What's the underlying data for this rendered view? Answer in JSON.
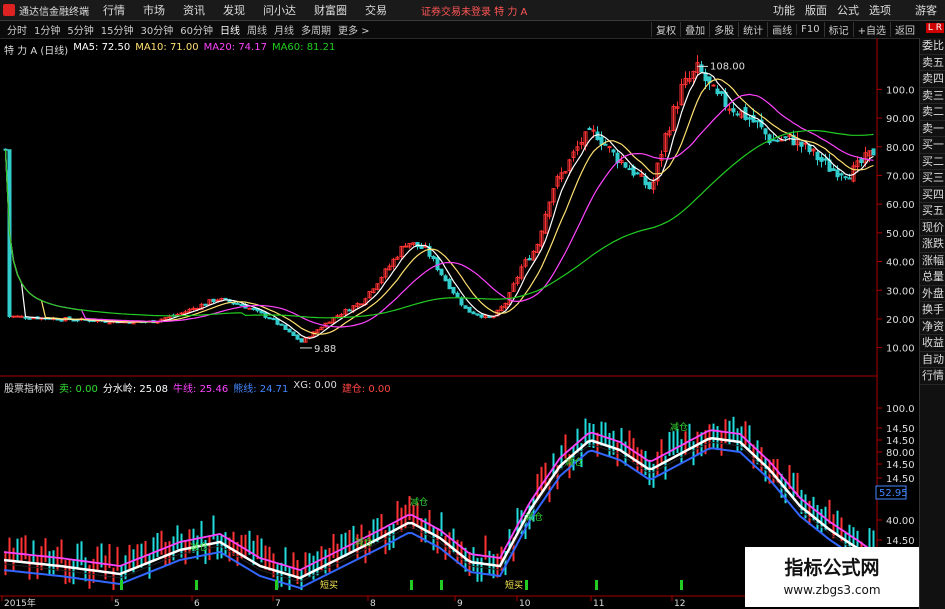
{
  "menubar": {
    "app_title": "通达信金融终端",
    "items": [
      "行情",
      "市场",
      "资讯",
      "发现",
      "问小达",
      "财富圈",
      "交易"
    ],
    "trade_status": "证券交易未登录  特 力 A",
    "right_items": [
      "功能",
      "版面",
      "公式",
      "选项"
    ],
    "guest": "游客"
  },
  "toolbar": {
    "timeframes": [
      "分时",
      "1分钟",
      "5分钟",
      "15分钟",
      "30分钟",
      "60分钟",
      "日线",
      "周线",
      "月线",
      "多周期",
      "更多 >"
    ],
    "active_timeframe": "日线",
    "tools": [
      "复权",
      "叠加",
      "多股",
      "统计",
      "画线",
      "F10",
      "标记",
      "+自选",
      "返回"
    ]
  },
  "main_chart": {
    "stock_label": "特 力 A (日线)",
    "ma5": "MA5: 72.50",
    "ma10": "MA10: 71.00",
    "ma20": "MA20: 74.17",
    "ma60": "MA60: 81.21",
    "high_label": "108.00",
    "low_label": "9.88",
    "axis_ticks": [
      "100.0",
      "90.00",
      "80.00",
      "70.00",
      "60.00",
      "50.00",
      "40.00",
      "30.00",
      "20.00",
      "10.00"
    ],
    "colors": {
      "ma5": "#ffffff",
      "ma10": "#ffe070",
      "ma20": "#ff44ff",
      "ma60": "#22cc22",
      "up": "#ff3333",
      "down": "#33cccc"
    }
  },
  "indicator": {
    "name": "股票指标网",
    "sell": "卖: 0.00",
    "water": "分水岭: 25.08",
    "bull": "牛线: 25.46",
    "bear": "熊线: 24.71",
    "xg": "XG: 0.00",
    "build": "建仓: 0.00",
    "axis_ticks": [
      "100.0",
      "14.50",
      "14.50",
      "80.00",
      "14.50",
      "14.50",
      "40.00",
      "14.50"
    ],
    "price_box": "52.95",
    "signals": [
      "减仓",
      "减仓",
      "减仓",
      "减仓",
      "减仓",
      "减仓"
    ],
    "buy_signals": [
      "短买",
      "短买"
    ]
  },
  "xaxis": {
    "labels": [
      "2015年",
      "5",
      "6",
      "7",
      "8",
      "9",
      "10",
      "11",
      "12"
    ]
  },
  "sidebar": {
    "badge": "L R",
    "items": [
      "委比",
      "卖五",
      "卖四",
      "卖三",
      "卖二",
      "卖一",
      "买一",
      "买二",
      "买三",
      "买四",
      "买五",
      "现价",
      "涨跌",
      "涨幅",
      "总量",
      "外盘",
      "换手",
      "净资",
      "收益",
      "自动",
      "行情"
    ]
  },
  "watermark": {
    "line1": "指标公式网",
    "line2": "www.zbgs3.com"
  }
}
